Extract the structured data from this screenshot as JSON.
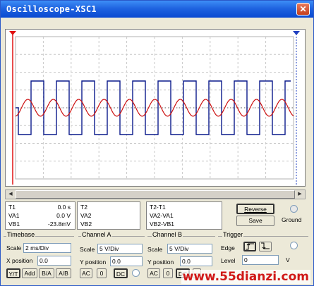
{
  "window": {
    "title": "Oscilloscope-XSC1",
    "close_glyph": "✕"
  },
  "colors": {
    "channel_a": "#cc1010",
    "channel_b": "#0a1a8c",
    "cursor_1": "#e01010",
    "cursor_2": "#2040c0",
    "grid": "#c8c8c8"
  },
  "measurement": {
    "t1": {
      "label": "T1",
      "time": "0.0 s",
      "va_label": "VA1",
      "va": "0.0 V",
      "vb_label": "VB1",
      "vb": "-23.8mV"
    },
    "t2": {
      "label": "T2",
      "va_label": "VA2",
      "vb_label": "VB2"
    },
    "diff": {
      "label": "T2-T1",
      "va_label": "VA2-VA1",
      "vb_label": "VB2-VB1"
    },
    "reverse_label": "Reverse",
    "save_label": "Save",
    "ground_label": "Ground"
  },
  "timebase": {
    "title": "Timebase",
    "scale_label": "Scale",
    "scale_value": "2 ms/Div",
    "xpos_label": "X position",
    "xpos_value": "0.0",
    "buttons": [
      "Y/T",
      "Add",
      "B/A",
      "A/B"
    ]
  },
  "channel_a": {
    "title": "Channel A",
    "scale_label": "Scale",
    "scale_value": "5 V/Div",
    "ypos_label": "Y position",
    "ypos_value": "0.0",
    "buttons": [
      "AC",
      "0",
      "DC"
    ]
  },
  "channel_b": {
    "title": "Channel B",
    "scale_label": "Scale",
    "scale_value": "5 V/Div",
    "ypos_label": "Y position",
    "ypos_value": "0.0",
    "buttons": [
      "AC",
      "0",
      "DC",
      "-"
    ]
  },
  "trigger": {
    "title": "Trigger",
    "edge_label": "Edge",
    "level_label": "Level",
    "level_value": "0",
    "level_unit": "V"
  },
  "watermark": "www.55dianzi.com"
}
